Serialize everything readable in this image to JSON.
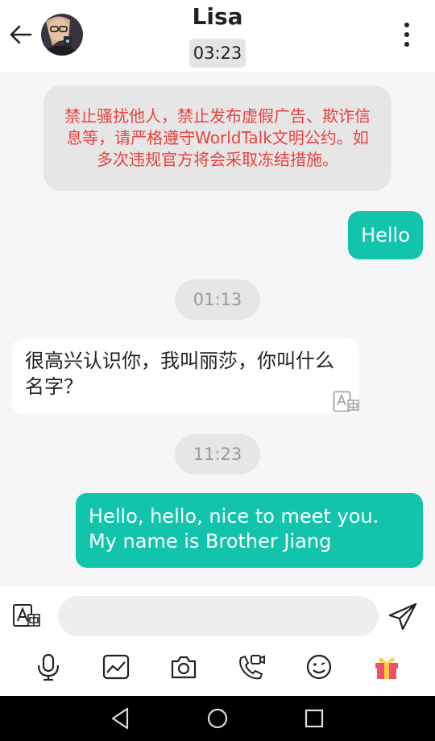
{
  "header": {
    "contact_name": "Lisa",
    "call_timer": "03:23",
    "icons": {
      "back": "back-arrow-icon",
      "more": "more-vertical-icon"
    }
  },
  "messages": {
    "notice": "禁止骚扰他人，禁止发布虚假广告、欺诈信息等，请严格遵守WorldTalk文明公约。如多次违规官方将会采取冻结措施。",
    "out_1": "Hello",
    "time_1": "01:13",
    "in_1": "很高兴认识你，我叫丽莎，你叫什么名字？",
    "time_2": "11:23",
    "out_2": "Hello, hello, nice to meet you. My name is Brother Jiang"
  },
  "input": {
    "placeholder": "",
    "icons": {
      "translate": "translate-icon",
      "send": "send-icon"
    }
  },
  "toolbar": {
    "icons": [
      "microphone-icon",
      "image-icon",
      "camera-icon",
      "video-call-icon",
      "emoji-icon",
      "gift-icon"
    ]
  },
  "colors": {
    "accent": "#12c4ac",
    "notice_text": "#e8423f",
    "gift": "#f0506e"
  }
}
